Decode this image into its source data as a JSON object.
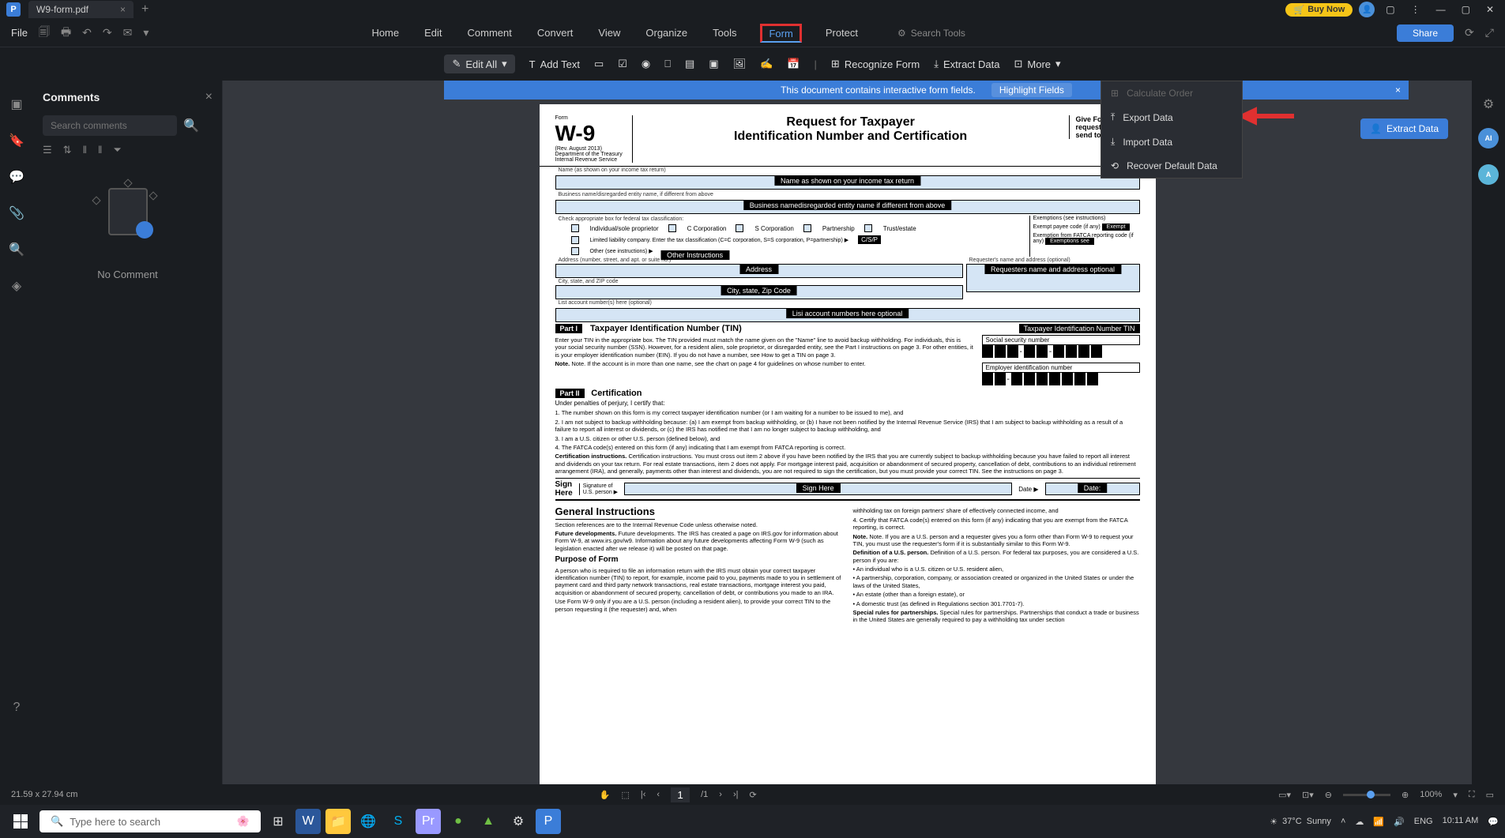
{
  "titlebar": {
    "tab_name": "W9-form.pdf",
    "buy_now": "Buy Now"
  },
  "filerow": {
    "file": "File",
    "tabs": [
      "Home",
      "Edit",
      "Comment",
      "Convert",
      "View",
      "Organize",
      "Tools",
      "Form",
      "Protect"
    ],
    "active_tab": "Form",
    "search_placeholder": "Search Tools",
    "share": "Share"
  },
  "toolbar": {
    "edit_all": "Edit All",
    "add_text": "Add Text",
    "recognize": "Recognize Form",
    "extract": "Extract Data",
    "more": "More"
  },
  "banner": {
    "msg": "This document contains interactive form fields.",
    "highlight": "Highlight Fields"
  },
  "extract_float": "Extract Data",
  "more_menu": {
    "calculate": "Calculate Order",
    "export": "Export Data",
    "import": "Import Data",
    "recover": "Recover Default Data"
  },
  "comments": {
    "title": "Comments",
    "search_placeholder": "Search comments",
    "empty": "No Comment"
  },
  "form": {
    "code": "W-9",
    "code_pre": "Form",
    "rev": "(Rev. August 2013)",
    "dept": "Department of the Treasury\nInternal Revenue Service",
    "title": "Request for Taxpayer\nIdentification Number and Certification",
    "give": "Give Form to requester. Do send to the IRS",
    "name_hint": "Name (as shown on your income tax return)",
    "name_label": "Name as shown on your income tax return",
    "biz_hint": "Business name/disregarded entity name, if different from above",
    "biz_label": "Business namedisregarded entity name if different from above",
    "check_hint": "Check appropriate box for federal tax classification:",
    "cb1": "Individual/sole proprietor",
    "cb2": "C Corporation",
    "cb3": "S Corporation",
    "cb4": "Partnership",
    "cb5": "Trust/estate",
    "exempt_hint": "Exemptions (see instructions)",
    "exempt_label": "Exempt",
    "csp": "C/S/P",
    "llc": "Limited liability company. Enter the tax classification (C=C corporation, S=S corporation, P=partnership) ▶",
    "payee_code": "Exempt payee code (if any)",
    "fatca": "Exemption from FATCA reporting code (if any)",
    "exemptions_see": "Exemptions see",
    "other_check": "Other (see instructions) ▶",
    "other_label": "Other Instructions",
    "addr_hint": "Address (number, street, and apt. or suite no.)",
    "addr_label": "Address",
    "req_hint": "Requester's name and address (optional)",
    "req_label": "Requesters name and address optional",
    "city_hint": "City, state, and ZIP code",
    "city_label": "City, state, Zip Code",
    "list_hint": "List account number(s) here (optional)",
    "list_label": "Lisi account numbers here optional",
    "part1": "Part I",
    "part1_title": "Taxpayer Identification Number (TIN)",
    "tin_label": "Taxpayer Identification Number TIN",
    "tin_text": "Enter your TIN in the appropriate box. The TIN provided must match the name given on the \"Name\" line to avoid backup withholding. For individuals, this is your social security number (SSN). However, for a resident alien, sole proprietor, or disregarded entity, see the Part I instructions on page 3. For other entities, it is your employer identification number (EIN). If you do not have a number, see How to get a TIN on page 3.",
    "tin_note": "Note. If the account is in more than one name, see the chart on page 4 for guidelines on whose number to enter.",
    "ssn": "Social security number",
    "ein": "Employer identification number",
    "part2": "Part II",
    "part2_title": "Certification",
    "cert_intro": "Under penalties of perjury, I certify that:",
    "cert1": "1.  The number shown on this form is my correct taxpayer identification number (or I am waiting for a number to be issued to me), and",
    "cert2": "2.  I am not subject to backup withholding because: (a) I am exempt from backup withholding, or (b) I have not been notified by the Internal Revenue Service (IRS) that I am subject to backup withholding as a result of a failure to report all interest or dividends, or (c) the IRS has notified me that I am no longer subject to backup withholding, and",
    "cert3": "3.  I am a U.S. citizen or other U.S. person (defined below), and",
    "cert4": "4.  The FATCA code(s) entered on this form (if any) indicating that I am exempt from FATCA reporting is correct.",
    "cert_inst": "Certification instructions. You must cross out item 2 above if you have been notified by the IRS that you are currently subject to backup withholding because you have failed to report all interest and dividends on your tax return. For real estate transactions, item 2 does not apply. For mortgage interest paid, acquisition or abandonment of secured property, cancellation of debt, contributions to an individual retirement arrangement (IRA), and generally, payments other than interest and dividends, you are not required to sign the certification, but you must provide your correct TIN. See the instructions on page 3.",
    "sign_here": "Sign\nHere",
    "sig_of": "Signature of\nU.S. person ▶",
    "sign_label": "Sign Here",
    "date": "Date ▶",
    "date_label": "Date:",
    "general": "General Instructions",
    "gen1": "Section references are to the Internal Revenue Code unless otherwise noted.",
    "future": "Future developments. The IRS has created a page on IRS.gov for information about Form W-9, at www.irs.gov/w9. Information about any future developments affecting Form W-9 (such as legislation enacted after we release it) will be posted on that page.",
    "purpose": "Purpose of Form",
    "purpose_text": "A person who is required to file an information return with the IRS must obtain your correct taxpayer identification number (TIN) to report, for example, income paid to you, payments made to you in settlement of payment card and third party network transactions, real estate transactions, mortgage interest you paid, acquisition or abandonment of secured property, cancellation of debt, or contributions you made to an IRA.",
    "purpose_text2": "Use Form W-9 only if you are a U.S. person (including a resident alien), to provide your correct TIN to the person requesting it (the requester) and, when",
    "col2_1": "withholding tax on foreign partners' share of effectively connected income, and",
    "col2_2": "4. Certify that FATCA code(s) entered on this form (if any) indicating that you are exempt from the FATCA reporting, is correct.",
    "col2_3": "Note. If you are a U.S. person and a requester gives you a form other than Form W-9 to request your TIN, you must use the requester's form if it is substantially similar to this Form W-9.",
    "col2_def": "Definition of a U.S. person. For federal tax purposes, you are considered a U.S. person if you are:",
    "col2_b1": "• An individual who is a U.S. citizen or U.S. resident alien,",
    "col2_b2": "• A partnership, corporation, company, or association created or organized in the United States or under the laws of the United States,",
    "col2_b3": "• An estate (other than a foreign estate), or",
    "col2_b4": "• A domestic trust (as defined in Regulations section 301.7701-7).",
    "col2_sp": "Special rules for partnerships. Partnerships that conduct a trade or business in the United States are generally required to pay a withholding tax under section"
  },
  "status": {
    "dim": "21.59 x 27.94 cm",
    "page_current": "1",
    "page_total": "/1",
    "zoom": "100%"
  },
  "taskbar": {
    "search": "Type here to search",
    "weather_temp": "37°C",
    "weather_cond": "Sunny",
    "lang": "ENG",
    "time": "10:11 AM"
  }
}
